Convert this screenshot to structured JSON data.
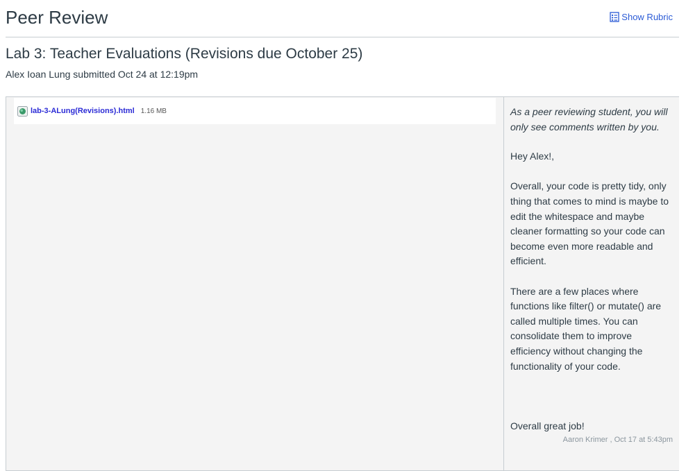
{
  "header": {
    "title": "Peer Review",
    "rubric_link": "Show Rubric",
    "rubric_icon": "rubric-icon"
  },
  "assignment": {
    "title": "Lab 3: Teacher Evaluations (Revisions due October 25)",
    "submitted_by": "Alex Ioan Lung submitted Oct 24 at 12:19pm"
  },
  "file": {
    "name": "lab-3-ALung(Revisions).html",
    "size": "1.16 MB",
    "icon": "html-file-icon"
  },
  "comments": {
    "notice": "As a peer reviewing student, you will only see comments written by you.",
    "body": "Hey Alex!,\n\nOverall, your code is pretty tidy, only thing that comes to mind is maybe to edit the whitespace and maybe cleaner formatting so your code can become even more readable and efficient.\n\nThere are a few places where functions like filter() or mutate() are called multiple times. You can consolidate them to improve efficiency without changing the functionality of your code.\n\n\n\nOverall great job!",
    "author": "Aaron Krimer , Oct 17 at 5:43pm"
  },
  "colors": {
    "link": "#2b5bd6",
    "text": "#2d3b45",
    "panel_bg": "#f4f4f4",
    "border": "#c7cdd1"
  }
}
